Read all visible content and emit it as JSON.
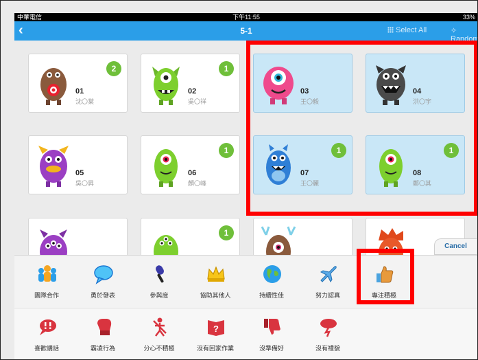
{
  "status_bar": {
    "carrier": "中華電信",
    "time": "下午11:55",
    "battery": "33%"
  },
  "nav": {
    "back_icon": "‹",
    "title": "5-1",
    "select_all": "Select All",
    "random": "Random"
  },
  "students": [
    {
      "number": "01",
      "name": "沈〇棠",
      "points": "2",
      "selected": false,
      "monster_color": "#8a5a3c"
    },
    {
      "number": "02",
      "name": "吳〇祥",
      "points": "1",
      "selected": false,
      "monster_color": "#7dcf2e"
    },
    {
      "number": "03",
      "name": "王〇毅",
      "points": "",
      "selected": true,
      "monster_color": "#ef4a8c"
    },
    {
      "number": "04",
      "name": "洪〇宇",
      "points": "",
      "selected": true,
      "monster_color": "#4a4a4a"
    },
    {
      "number": "05",
      "name": "吳〇昇",
      "points": "",
      "selected": false,
      "monster_color": "#9b3fc3"
    },
    {
      "number": "06",
      "name": "顏〇峰",
      "points": "1",
      "selected": false,
      "monster_color": "#7dcf2e"
    },
    {
      "number": "07",
      "name": "王〇麗",
      "points": "1",
      "selected": true,
      "monster_color": "#2f7fd6"
    },
    {
      "number": "08",
      "name": "鄭〇其",
      "points": "1",
      "selected": true,
      "monster_color": "#7dcf2e"
    }
  ],
  "cancel_label": "Cancel",
  "positive_skills": [
    "團隊合作",
    "勇於發表",
    "參與度",
    "協助其他人",
    "持續性佳",
    "努力認真",
    "專注積極"
  ],
  "negative_skills": [
    "喜歡講話",
    "霸凌行為",
    "分心不積極",
    "沒有回家作業",
    "沒準備好",
    "沒有禮貌"
  ],
  "colors": {
    "accent": "#2b9ee8",
    "badge": "#6fbf3a",
    "highlight": "#ff0000",
    "negative": "#d9343f"
  }
}
